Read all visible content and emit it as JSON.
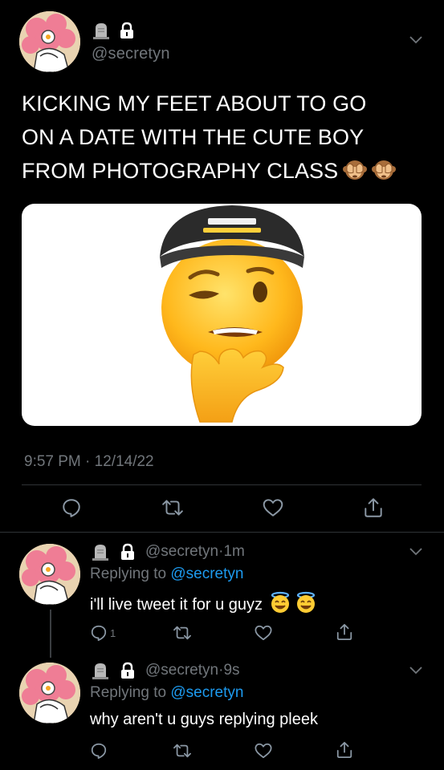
{
  "colors": {
    "background": "#000000",
    "text_primary": "#ffffff",
    "text_secondary": "#71767b",
    "link": "#1d9bf0",
    "divider": "#2f3336"
  },
  "main_tweet": {
    "handle": "@secretyn",
    "text": "KICKING MY FEET ABOUT TO GO\nON A DATE WITH THE CUTE BOY\nFROM PHOTOGRAPHY CLASS",
    "trailing_emojis": [
      "see-no-evil-monkey",
      "see-no-evil-monkey"
    ],
    "media_description_icon": "smirking-face-with-cap-emoji",
    "time": "9:57 PM",
    "separator": "·",
    "date": "12/14/22",
    "actions": [
      "reply-icon",
      "retweet-icon",
      "like-icon",
      "share-icon"
    ]
  },
  "replies": [
    {
      "handle": "@secretyn",
      "separator": "·",
      "age": "1m",
      "replying_prefix": "Replying to",
      "replying_handle": "@secretyn",
      "text": "i'll live tweet it for u guyz",
      "trailing_emojis": [
        "smiling-face-with-halo",
        "smiling-face-with-halo"
      ],
      "reply_count": "1"
    },
    {
      "handle": "@secretyn",
      "separator": "·",
      "age": "9s",
      "replying_prefix": "Replying to",
      "replying_handle": "@secretyn",
      "text": "why aren't u guys replying pleek",
      "trailing_emojis": [],
      "reply_count": ""
    }
  ]
}
